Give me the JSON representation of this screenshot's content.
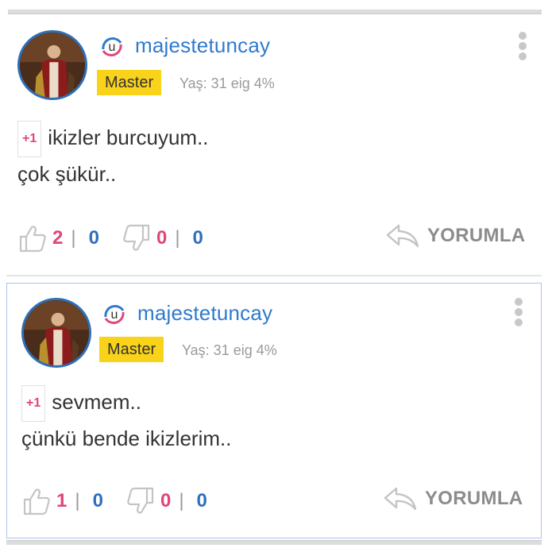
{
  "comments": [
    {
      "username": "majestetuncay",
      "rank": "Master",
      "meta": "Yaş: 31 eig 4%",
      "plus_badge": "+1",
      "lines": [
        "ikizler burcuyum..",
        "çok şükür.."
      ],
      "likes": "2",
      "likes_second": "0",
      "dislikes": "0",
      "dislikes_second": "0",
      "pipe": "|",
      "reply_label": "YORUMLA"
    },
    {
      "username": "majestetuncay",
      "rank": "Master",
      "meta": "Yaş: 31 eig 4%",
      "plus_badge": "+1",
      "lines": [
        "sevmem..",
        "çünkü bende ikizlerim.."
      ],
      "likes": "1",
      "likes_second": "0",
      "dislikes": "0",
      "dislikes_second": "0",
      "pipe": "|",
      "reply_label": "YORUMLA"
    }
  ],
  "brand_icon_letter": "u",
  "icons": {
    "brand": "uludag-logo-icon",
    "like": "thumbs-up-icon",
    "dislike": "thumbs-down-icon",
    "reply": "reply-arrow-icon",
    "menu": "kebab-menu-icon"
  },
  "colors": {
    "accent_blue": "#2f7ad0",
    "accent_pink": "#e0457b",
    "badge_yellow": "#f9d21a",
    "muted": "#9a9a9a"
  }
}
